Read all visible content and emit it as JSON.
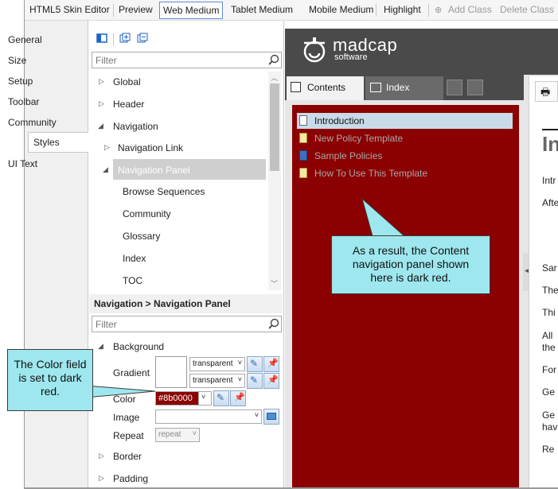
{
  "toolbar": {
    "items": [
      "HTML5 Skin Editor",
      "Preview",
      "Web Medium",
      "Tablet Medium",
      "Mobile Medium",
      "Highlight",
      "Add Class",
      "Delete Class"
    ]
  },
  "left_tabs": [
    "General",
    "Size",
    "Setup",
    "Toolbar",
    "Community",
    "Styles",
    "UI Text"
  ],
  "tree": {
    "filter_placeholder": "Filter",
    "nodes": [
      "Global",
      "Header",
      "Navigation",
      "Navigation Link",
      "Navigation Panel",
      "Browse Sequences",
      "Community",
      "Glossary",
      "Index",
      "TOC"
    ]
  },
  "properties": {
    "breadcrumb": "Navigation > Navigation Panel",
    "filter_placeholder": "Filter",
    "background_label": "Background",
    "gradient_label": "Gradient",
    "gradient_value1": "transparent",
    "gradient_value2": "transparent",
    "color_label": "Color",
    "color_value": "#8b0000",
    "image_label": "Image",
    "repeat_label": "Repeat",
    "repeat_value": "repeat",
    "border_label": "Border",
    "padding_label": "Padding"
  },
  "preview": {
    "logo_text": "madcap",
    "logo_subtext": "software",
    "tab_contents": "Contents",
    "tab_index": "Index",
    "nav_items": [
      "Introduction",
      "New Policy Template",
      "Sample Policies",
      "How To Use This Template"
    ],
    "right_text": [
      "Intr",
      "Afte",
      "Sar",
      "The",
      "Thi",
      "All",
      "the",
      "For",
      "Ge",
      "Ge",
      "hav",
      "Re"
    ],
    "right_heading": "In",
    "nav_panel_color": "#8b0000"
  },
  "callouts": {
    "right": "As a result, the Content navigation panel shown here is dark red.",
    "left": "The Color field is set to dark red."
  }
}
